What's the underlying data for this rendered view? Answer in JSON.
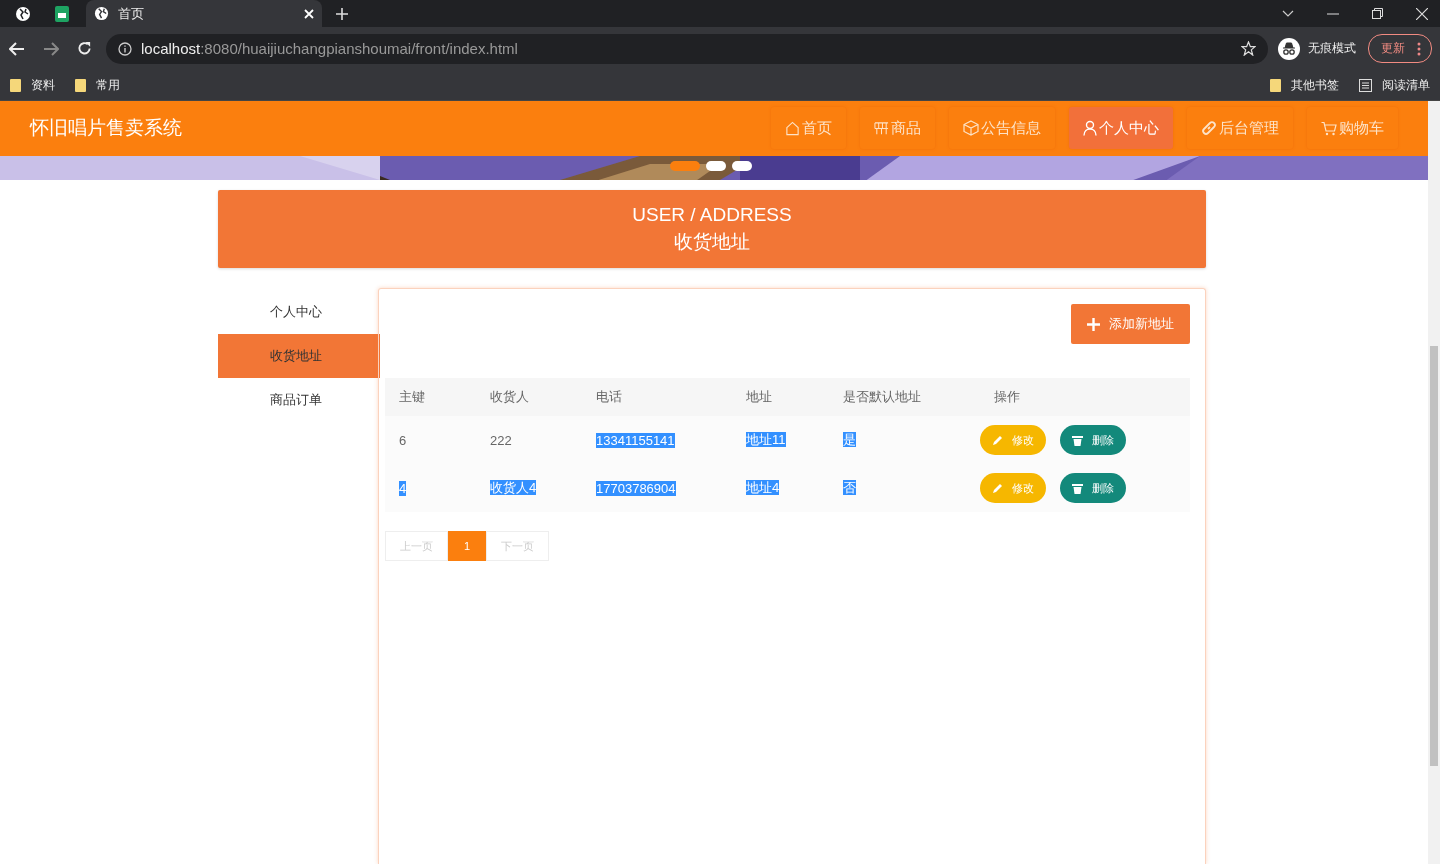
{
  "browser": {
    "tab_title": "首页",
    "url_host": "localhost",
    "url_path": ":8080/huaijiuchangpianshoumai/front/index.html",
    "incognito_label": "无痕模式",
    "update_label": "更新",
    "bookmarks": [
      "资料",
      "常用"
    ],
    "bookmarks_right": [
      "其他书签",
      "阅读清单"
    ]
  },
  "site": {
    "title": "怀旧唱片售卖系统",
    "nav": [
      {
        "label": "首页",
        "selected": false
      },
      {
        "label": "商品",
        "selected": false
      },
      {
        "label": "公告信息",
        "selected": false
      },
      {
        "label": "个人中心",
        "selected": true
      },
      {
        "label": "后台管理",
        "selected": false
      },
      {
        "label": "购物车",
        "selected": false
      }
    ],
    "carousel_dots": [
      {
        "selected": true
      },
      {
        "selected": false
      },
      {
        "selected": false
      }
    ]
  },
  "heading": {
    "en": "USER / ADDRESS",
    "zh": "收货地址"
  },
  "sidebar": [
    {
      "label": "个人中心",
      "selected": false
    },
    {
      "label": "收货地址",
      "selected": true
    },
    {
      "label": "商品订单",
      "selected": false
    }
  ],
  "add_button": "添加新地址",
  "table": {
    "columns": [
      "主键",
      "收货人",
      "电话",
      "地址",
      "是否默认地址",
      "操作"
    ],
    "rows": [
      {
        "cells": [
          {
            "text": "6",
            "highlighted": false
          },
          {
            "text": "222",
            "highlighted": false
          },
          {
            "text": "13341155141",
            "highlighted": true
          },
          {
            "text": "地址11",
            "highlighted": true
          },
          {
            "text": "是",
            "highlighted": true
          }
        ],
        "edit": "修改",
        "delete": "删除"
      },
      {
        "cells": [
          {
            "text": "4",
            "highlighted": true
          },
          {
            "text": "收货人4",
            "highlighted": true
          },
          {
            "text": "17703786904",
            "highlighted": true
          },
          {
            "text": "地址4",
            "highlighted": true
          },
          {
            "text": "否",
            "highlighted": true
          }
        ],
        "edit": "修改",
        "delete": "删除"
      }
    ]
  },
  "pagination": {
    "prev": "上一页",
    "pages": [
      {
        "label": "1",
        "selected": true
      }
    ],
    "next": "下一页"
  }
}
